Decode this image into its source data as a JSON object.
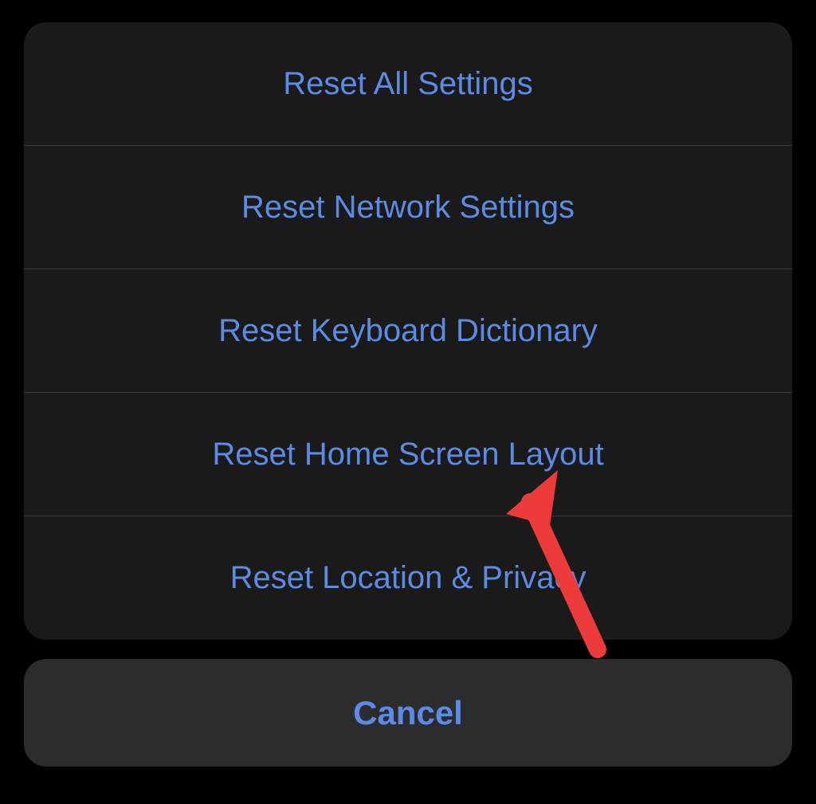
{
  "actions": [
    "Reset All Settings",
    "Reset Network Settings",
    "Reset Keyboard Dictionary",
    "Reset Home Screen Layout",
    "Reset Location & Privacy"
  ],
  "cancel_label": "Cancel",
  "colors": {
    "accent": "#5c8be6",
    "sheet_bg": "#1a1a1a",
    "cancel_bg": "#2c2c2e",
    "divider": "#3a3a3a",
    "arrow": "#ed3b3b"
  }
}
